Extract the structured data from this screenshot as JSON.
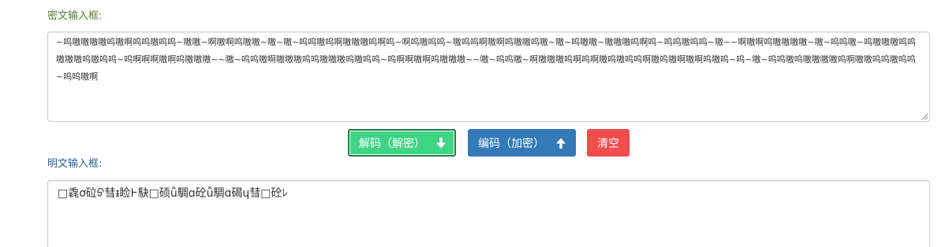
{
  "cipher": {
    "label": "密文输入框:",
    "value": "~呜嗷嗷嗷嗷呜嗷啊呜呜嗷呜呜~嗷嗷~啊嗷啊呜嗷嗷~嗷~嗷~呜呜嗷呜啊嗷嗷嗷呜啊呜~啊呜嗷呜呜~嗷呜呜啊嗷啊呜嗷嗷呜嗷~嗷~呜嗷嗷~嗷嗷嗷呜啊呜~呜呜嗷呜呜~嗷~~啊嗷啊呜嗷嗷嗷嗷~嗷~呜呜嗷~呜嗷嗷嗷呜呜嗷嗷嗷呜嗷呜呜~呜啊啊啊嗷啊呜嗷嗷嗷~~嗷~呜呜嗷啊嗷嗷嗷呜呜嗷嗷嗷呜嗷呜呜~呜啊啊嗷啊呜嗷嗷嗷~~嗷~呜呜嗷~啊嗷嗷嗷呜啊呜啊嗷呜嗷呜呜啊嗷呜嗷啊嗷啊呜嗷呜~呜~嗷~呜呜嗷呜嗷嗷嗷嗷呜啊嗷嗷呜呜嗷呜呜~呜呜嗷啊"
  },
  "buttons": {
    "decode_label": "解码（解密）",
    "encode_label": "编码（加密）",
    "clear_label": "清空"
  },
  "plain": {
    "label": "明文输入框:",
    "value": "□毳ơ砬ᢒ彗ᵻ睑Ⱶ駃□硕ǚ騆ɑ砼ǚ騆ɑ碣ɥ彗□砼ﾚ"
  },
  "colors": {
    "decode_bg": "#3fd585",
    "encode_bg": "#337ab7",
    "clear_bg": "#f24c4c",
    "cipher_label": "#5a7a2b",
    "plain_label": "#2a5f8f"
  },
  "icons": {
    "decode": "arrow-down-icon",
    "encode": "arrow-up-icon"
  }
}
